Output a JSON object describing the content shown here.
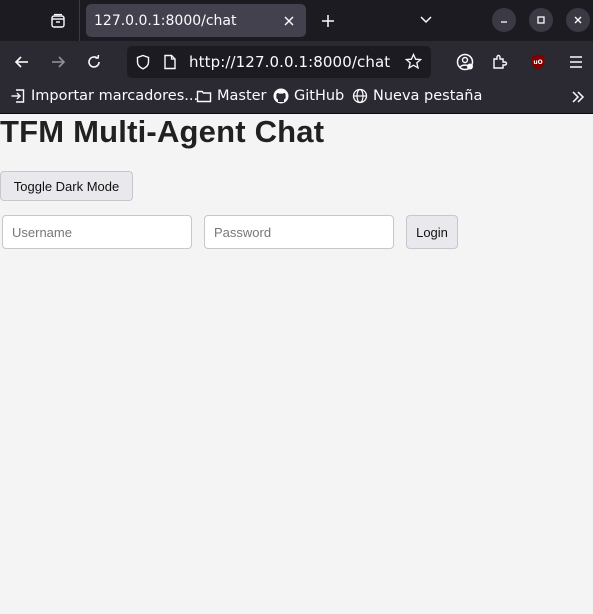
{
  "browser": {
    "tab_title": "127.0.0.1:8000/chat",
    "url": "http://127.0.0.1:8000/chat",
    "bookmarks": [
      {
        "label": "Importar marcadores...",
        "icon": "import-icon"
      },
      {
        "label": "Master",
        "icon": "folder-icon"
      },
      {
        "label": "GitHub",
        "icon": "github-icon"
      },
      {
        "label": "Nueva pestaña",
        "icon": "globe-icon"
      }
    ],
    "accent": "#1c1b22"
  },
  "page": {
    "title": "TFM Multi-Agent Chat",
    "toggle_label": "Toggle Dark Mode",
    "username_placeholder": "Username",
    "username_value": "",
    "password_placeholder": "Password",
    "password_value": "",
    "login_label": "Login",
    "background": "#f4f4f4"
  }
}
